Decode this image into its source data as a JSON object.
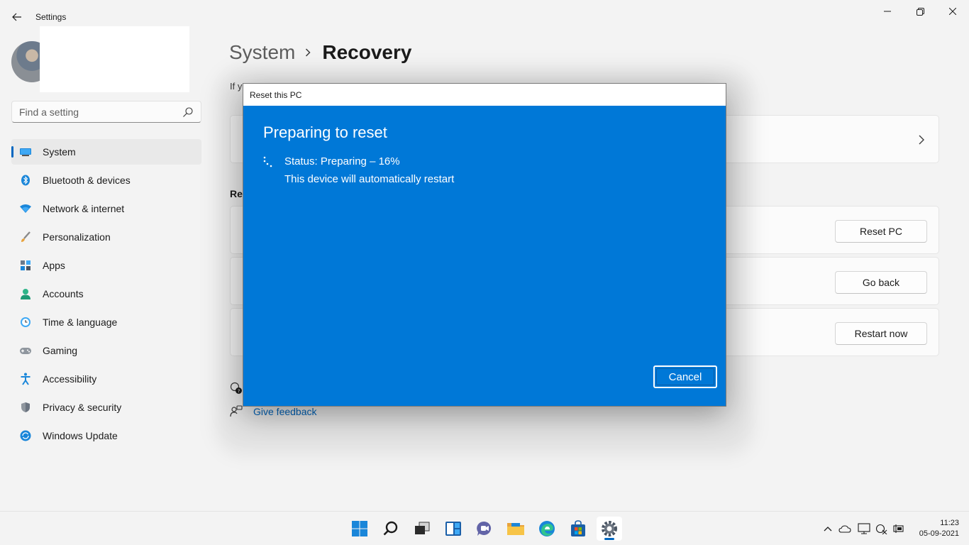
{
  "window": {
    "title": "Settings",
    "controls": {
      "minimize": "minimize-icon",
      "maximize": "restore-icon",
      "close": "close-icon"
    }
  },
  "search": {
    "placeholder": "Find a setting",
    "value": ""
  },
  "sidebar": {
    "items": [
      {
        "label": "System",
        "icon": "display-icon",
        "active": true
      },
      {
        "label": "Bluetooth & devices",
        "icon": "bluetooth-icon"
      },
      {
        "label": "Network & internet",
        "icon": "wifi-icon"
      },
      {
        "label": "Personalization",
        "icon": "brush-icon"
      },
      {
        "label": "Apps",
        "icon": "apps-icon"
      },
      {
        "label": "Accounts",
        "icon": "person-icon"
      },
      {
        "label": "Time & language",
        "icon": "clock-globe-icon"
      },
      {
        "label": "Gaming",
        "icon": "gamepad-icon"
      },
      {
        "label": "Accessibility",
        "icon": "accessibility-icon"
      },
      {
        "label": "Privacy & security",
        "icon": "shield-icon"
      },
      {
        "label": "Windows Update",
        "icon": "update-icon"
      }
    ]
  },
  "main": {
    "breadcrumb": {
      "parent": "System",
      "current": "Recovery"
    },
    "description": "If y",
    "section_label": "Rec",
    "cards": {
      "reset_button": "Reset PC",
      "goback_button": "Go back",
      "restart_button": "Restart now"
    },
    "help": {
      "feedback": "Give feedback"
    }
  },
  "dialog": {
    "title": "Reset this PC",
    "heading": "Preparing to reset",
    "status": "Status: Preparing – 16%",
    "progress_percent": 16,
    "note": "This device will automatically restart",
    "cancel_label": "Cancel"
  },
  "taskbar": {
    "apps": [
      "start-icon",
      "search-icon",
      "task-view-icon",
      "widgets-icon",
      "chat-icon",
      "file-explorer-icon",
      "edge-icon",
      "store-icon",
      "settings-icon"
    ],
    "tray": [
      "chevron-up-icon",
      "onedrive-icon",
      "display-icon",
      "network-icon",
      "battery-icon"
    ],
    "time": "11:23",
    "date": "05-09-2021"
  },
  "colors": {
    "accent": "#0067c0",
    "dialog_bg": "#0078d7"
  }
}
